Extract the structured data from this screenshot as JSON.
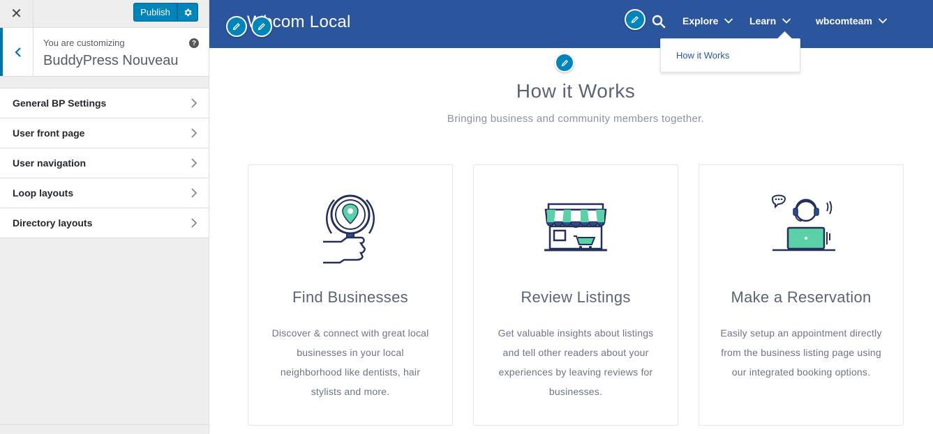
{
  "sidebar": {
    "close_label": "✕",
    "publish_label": "Publish",
    "customizing_label": "You are customizing",
    "theme_name": "BuddyPress Nouveau",
    "help_label": "?",
    "items": [
      {
        "label": "General BP Settings"
      },
      {
        "label": "User front page"
      },
      {
        "label": "User navigation"
      },
      {
        "label": "Loop layouts"
      },
      {
        "label": "Directory layouts"
      }
    ]
  },
  "site": {
    "brand": "Wbcom Local",
    "nav": {
      "explore": "Explore",
      "learn": "Learn",
      "user": "wbcomteam"
    },
    "dropdown_item": "How it Works",
    "section_title": "How it Works",
    "section_subtitle": "Bringing business and community members together.",
    "cards": [
      {
        "icon": "magnifier-pin-icon",
        "title": "Find Businesses",
        "text": "Discover & connect with great local businesses in your local neighborhood like dentists, hair stylists and more."
      },
      {
        "icon": "storefront-icon",
        "title": "Review Listings",
        "text": "Get valuable insights about listings and tell other readers about your experiences by leaving reviews for businesses."
      },
      {
        "icon": "support-agent-icon",
        "title": "Make a Reservation",
        "text": "Easily setup an appointment directly from the business listing page using our integrated booking options."
      }
    ]
  },
  "colors": {
    "topbar": "#2b559c",
    "accent": "#0085ba",
    "icon_teal": "#5ad1a8",
    "icon_navy": "#25305a"
  }
}
